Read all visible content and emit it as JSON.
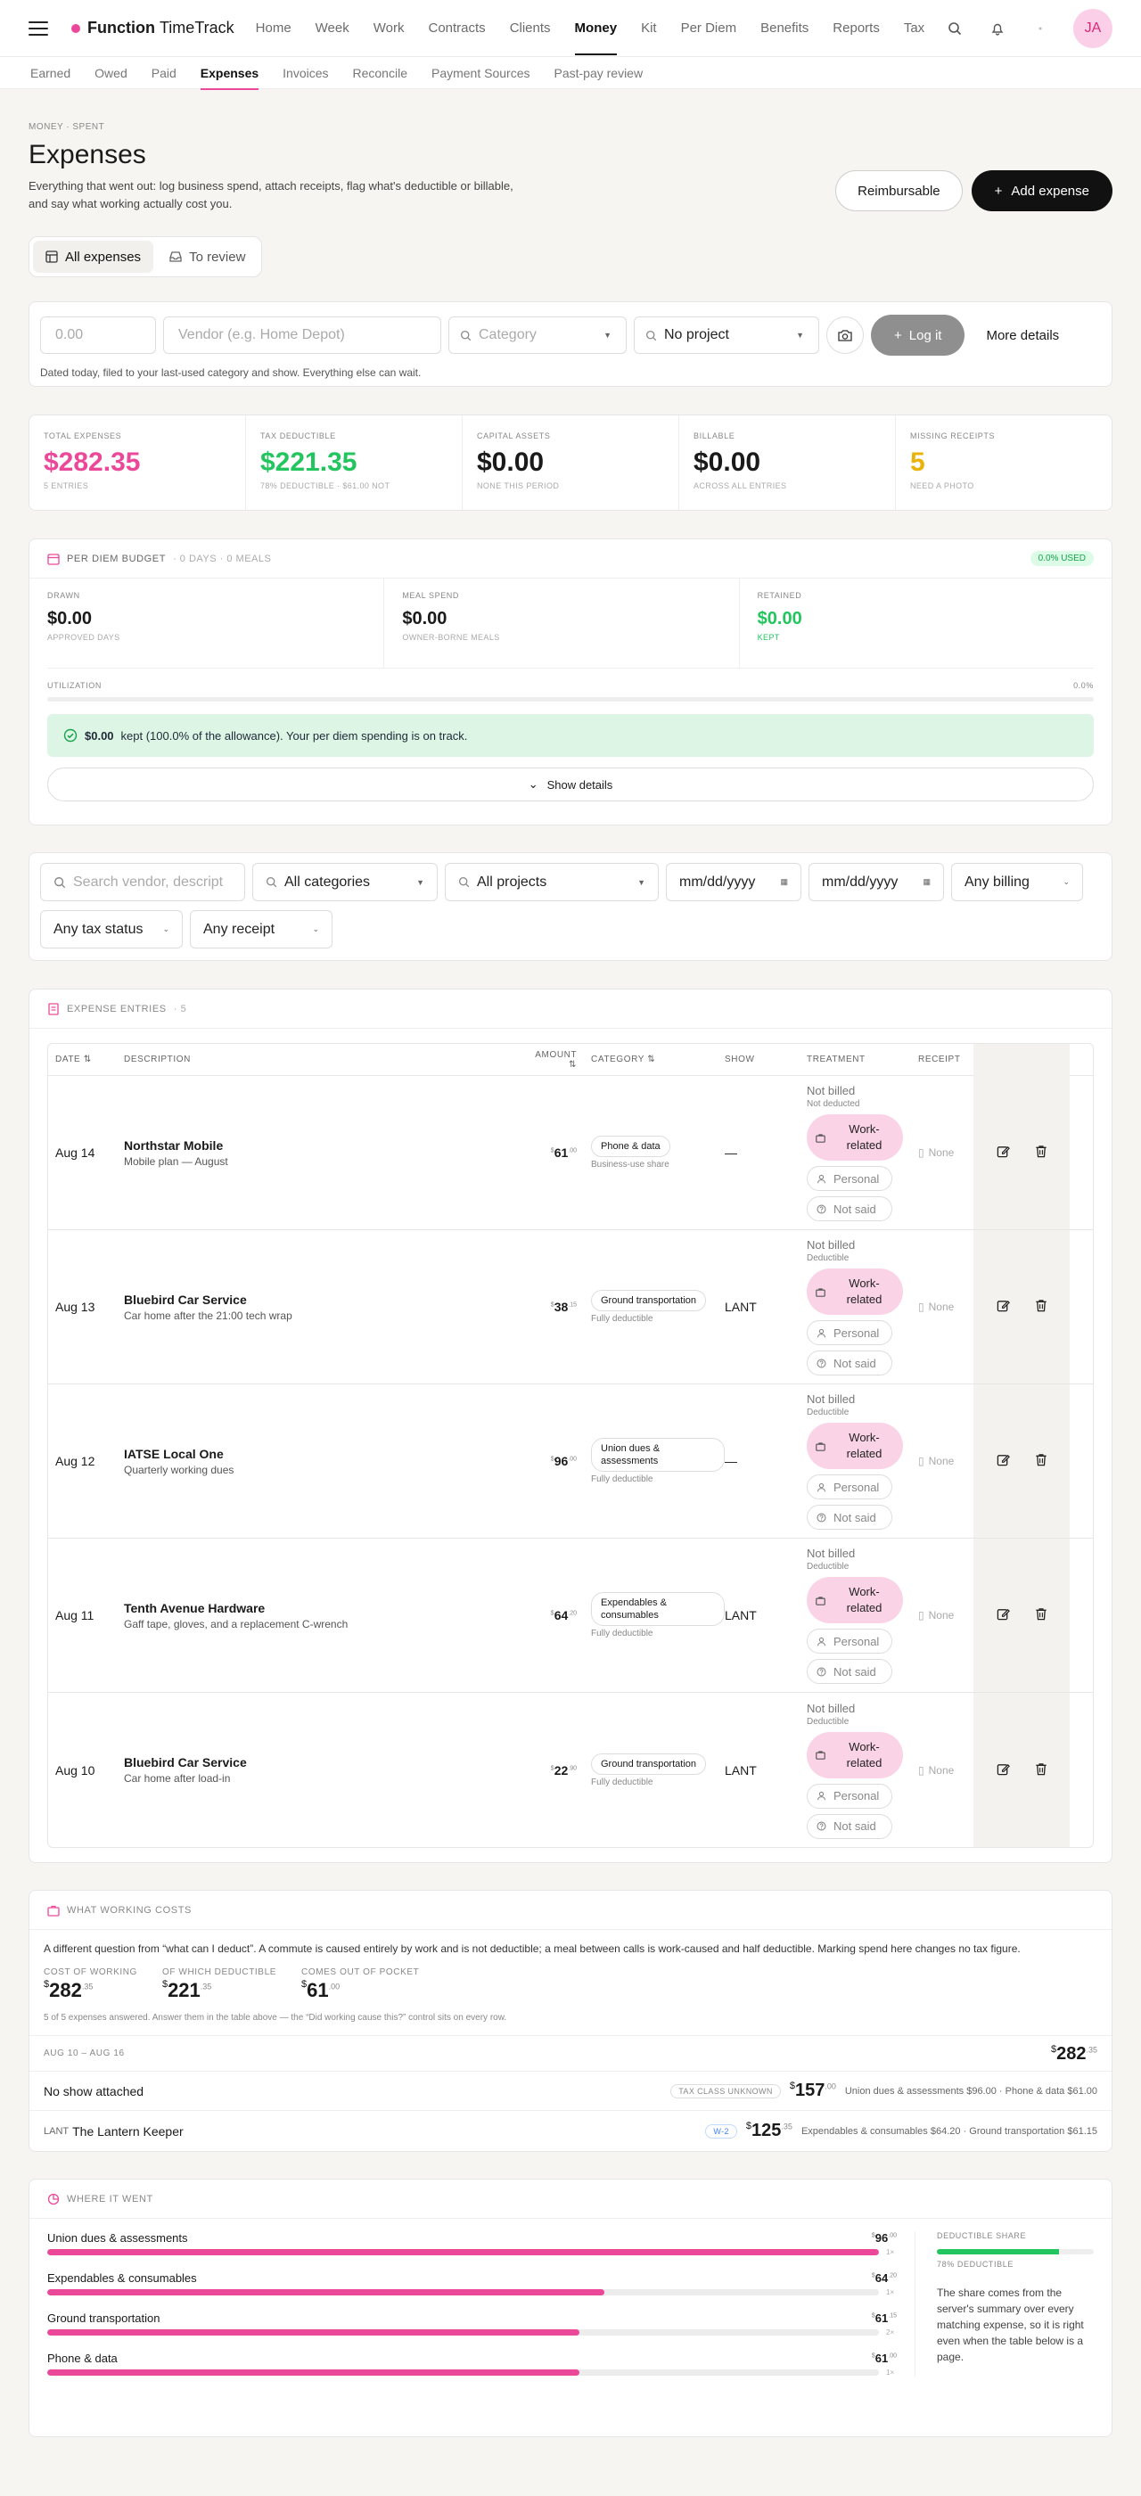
{
  "brand": {
    "bold": "Function",
    "light": "TimeTrack"
  },
  "nav": [
    "Home",
    "Week",
    "Work",
    "Contracts",
    "Clients",
    "Money",
    "Kit",
    "Per Diem",
    "Benefits",
    "Reports",
    "Tax"
  ],
  "nav_active": "Money",
  "user": {
    "initials": "JA"
  },
  "subnav": [
    "Earned",
    "Owed",
    "Paid",
    "Expenses",
    "Invoices",
    "Reconcile",
    "Payment Sources",
    "Past-pay review"
  ],
  "page": {
    "crumb": "MONEY · SPENT",
    "title": "Expenses",
    "lede": "Everything that went out: log business spend, attach receipts, flag what's deductible or billable, and say what working actually cost you.",
    "btn_reimbursable": "Reimbursable",
    "btn_add": "Add expense"
  },
  "tabs": {
    "all": "All expenses",
    "review": "To review"
  },
  "quick": {
    "amount_placeholder": "0.00",
    "vendor_placeholder": "Vendor (e.g. Home Depot)",
    "category_placeholder": "Category",
    "project_value": "No project",
    "log_label": "Log it",
    "more_label": "More details",
    "note": "Dated today, filed to your last-used category and show. Everything else can wait."
  },
  "stats": [
    {
      "label": "TOTAL EXPENSES",
      "value": "$282.35",
      "sub": "5 ENTRIES",
      "color": "#ec4899"
    },
    {
      "label": "TAX DEDUCTIBLE",
      "value": "$221.35",
      "sub": "78% DEDUCTIBLE · $61.00 NOT",
      "color": "#22c55e"
    },
    {
      "label": "CAPITAL ASSETS",
      "value": "$0.00",
      "sub": "NONE THIS PERIOD",
      "color": "#111111"
    },
    {
      "label": "BILLABLE",
      "value": "$0.00",
      "sub": "ACROSS ALL ENTRIES",
      "color": "#111111"
    },
    {
      "label": "MISSING RECEIPTS",
      "value": "5",
      "sub": "NEED A PHOTO",
      "color": "#eab308"
    }
  ],
  "perdiem": {
    "title": "PER DIEM BUDGET",
    "meta": "· 0 DAYS · 0 MEALS",
    "used": "0.0% USED",
    "drawn": {
      "label": "DRAWN",
      "value": "$0.00",
      "sub": "APPROVED DAYS"
    },
    "meal": {
      "label": "MEAL SPEND",
      "value": "$0.00",
      "sub": "OWNER-BORNE MEALS"
    },
    "retained": {
      "label": "RETAINED",
      "value": "$0.00",
      "sub": "KEPT"
    },
    "util_label": "UTILIZATION",
    "util_value": "0.0%",
    "util_fraction": 0,
    "ok_amount": "$0.00",
    "ok_text": "kept (100.0% of the allowance). Your per diem spending is on track.",
    "show_details": "Show details"
  },
  "filters": {
    "search_placeholder": "Search vendor, descript",
    "categories": "All categories",
    "projects": "All projects",
    "date_from": "mm/dd/yyyy",
    "date_to": "mm/dd/yyyy",
    "billing": "Any billing",
    "tax_status": "Any tax status",
    "receipt": "Any receipt"
  },
  "entries": {
    "title": "EXPENSE ENTRIES",
    "count": "· 5",
    "headers": {
      "date": "DATE",
      "description": "DESCRIPTION",
      "amount": "AMOUNT",
      "category": "CATEGORY",
      "show": "SHOW",
      "treatment": "TREATMENT",
      "receipt": "RECEIPT"
    },
    "rows": [
      {
        "date": "Aug 14",
        "vendor": "Northstar Mobile",
        "memo": "Mobile plan — August",
        "amount": "61",
        "cents": ".00",
        "category": "Phone & data",
        "cat_note": "Business-use share",
        "show": "—",
        "billed": "Not billed",
        "deduct": "Not deducted",
        "work": "Work-related",
        "personal": "Personal",
        "notsaid": "Not said",
        "receipt": "None"
      },
      {
        "date": "Aug 13",
        "vendor": "Bluebird Car Service",
        "memo": "Car home after the 21:00 tech wrap",
        "amount": "38",
        "cents": ".15",
        "category": "Ground transportation",
        "cat_note": "Fully deductible",
        "show": "LANT",
        "billed": "Not billed",
        "deduct": "Deductible",
        "work": "Work-related",
        "personal": "Personal",
        "notsaid": "Not said",
        "receipt": "None"
      },
      {
        "date": "Aug 12",
        "vendor": "IATSE Local One",
        "memo": "Quarterly working dues",
        "amount": "96",
        "cents": ".00",
        "category": "Union dues & assessments",
        "cat_note": "Fully deductible",
        "show": "—",
        "billed": "Not billed",
        "deduct": "Deductible",
        "work": "Work-related",
        "personal": "Personal",
        "notsaid": "Not said",
        "receipt": "None"
      },
      {
        "date": "Aug 11",
        "vendor": "Tenth Avenue Hardware",
        "memo": "Gaff tape, gloves, and a replacement C-wrench",
        "amount": "64",
        "cents": ".20",
        "category": "Expendables & consumables",
        "cat_note": "Fully deductible",
        "show": "LANT",
        "billed": "Not billed",
        "deduct": "Deductible",
        "work": "Work-related",
        "personal": "Personal",
        "notsaid": "Not said",
        "receipt": "None"
      },
      {
        "date": "Aug 10",
        "vendor": "Bluebird Car Service",
        "memo": "Car home after load-in",
        "amount": "22",
        "cents": ".90",
        "category": "Ground transportation",
        "cat_note": "Fully deductible",
        "show": "LANT",
        "billed": "Not billed",
        "deduct": "Deductible",
        "work": "Work-related",
        "personal": "Personal",
        "notsaid": "Not said",
        "receipt": "None"
      }
    ]
  },
  "costs": {
    "title": "WHAT WORKING COSTS",
    "intro": "A different question from “what can I deduct”. A commute is caused entirely by work and is not deductible; a meal between calls is work-caused and half deductible. Marking spend here changes no tax figure.",
    "cost_label": "COST OF WORKING",
    "cost_value": "282",
    "cost_cents": ".35",
    "ded_label": "OF WHICH DEDUCTIBLE",
    "ded_value": "221",
    "ded_cents": ".35",
    "oop_label": "COMES OUT OF POCKET",
    "oop_value": "61",
    "oop_cents": ".00",
    "note": "5 of 5 expenses answered. Answer them in the table above — the “Did working cause this?” control sits on every row.",
    "range": "AUG 10 – AUG 16",
    "range_total": "282",
    "range_cents": ".35",
    "row1_name": "No show attached",
    "row1_tag": "TAX CLASS UNKNOWN",
    "row1_total": "157",
    "row1_cents": ".00",
    "row1_detail": "Union dues & assessments $96.00 · Phone & data $61.00",
    "row2_code": "LANT",
    "row2_name": "The Lantern Keeper",
    "row2_tag": "W-2",
    "row2_total": "125",
    "row2_cents": ".35",
    "row2_detail": "Expendables & consumables $64.20 · Ground transportation $61.15"
  },
  "where": {
    "title": "WHERE IT WENT",
    "items": [
      {
        "name": "Union dues & assessments",
        "amount": "96",
        "cents": ".00",
        "count": "1×",
        "fraction": 1.0
      },
      {
        "name": "Expendables & consumables",
        "amount": "64",
        "cents": ".20",
        "count": "1×",
        "fraction": 0.67
      },
      {
        "name": "Ground transportation",
        "amount": "61",
        "cents": ".15",
        "count": "2×",
        "fraction": 0.64
      },
      {
        "name": "Phone & data",
        "amount": "61",
        "cents": ".00",
        "count": "1×",
        "fraction": 0.64
      }
    ],
    "ded_label": "DEDUCTIBLE SHARE",
    "ded_value": "78% DEDUCTIBLE",
    "ded_fraction": 0.78,
    "ded_note": "The share comes from the server's summary over every matching expense, so it is right even when the table below is a page."
  },
  "colors": {
    "accent": "#ec4899",
    "green": "#22c55e",
    "amber": "#eab308",
    "dark": "#111111"
  }
}
